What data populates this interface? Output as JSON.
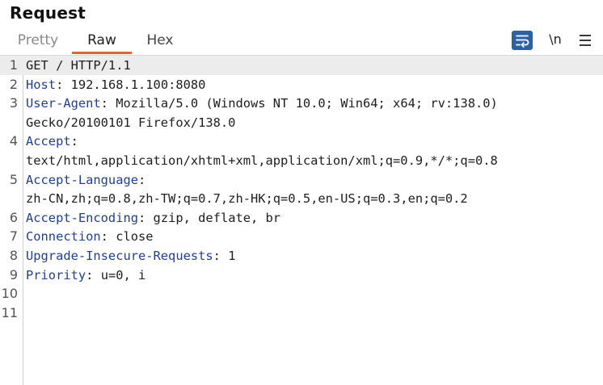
{
  "panel": {
    "title": "Request"
  },
  "tabs": [
    {
      "label": "Pretty",
      "active": false
    },
    {
      "label": "Raw",
      "active": true
    },
    {
      "label": "Hex",
      "active": false
    }
  ],
  "toolbar": {
    "wrap_icon": "wrap-lines-icon",
    "newline_label": "\\n",
    "menu_icon": "hamburger-menu-icon"
  },
  "colors": {
    "accent_tab": "#e8642e",
    "header_name": "#1f3f9f",
    "wrap_button": "#2a62a8"
  },
  "lines": [
    {
      "num": "1",
      "rows": [
        {
          "plain": "GET / HTTP/1.1"
        }
      ]
    },
    {
      "num": "2",
      "rows": [
        {
          "name": "Host",
          "value": " 192.168.1.100:8080"
        }
      ]
    },
    {
      "num": "3",
      "rows": [
        {
          "name": "User-Agent",
          "value": " Mozilla/5.0 (Windows NT 10.0; Win64; x64; rv:138.0)"
        },
        {
          "plain": "Gecko/20100101 Firefox/138.0"
        }
      ]
    },
    {
      "num": "4",
      "rows": [
        {
          "name": "Accept",
          "value": ""
        },
        {
          "plain": "text/html,application/xhtml+xml,application/xml;q=0.9,*/*;q=0.8"
        }
      ]
    },
    {
      "num": "5",
      "rows": [
        {
          "name": "Accept-Language",
          "value": ""
        },
        {
          "plain": "zh-CN,zh;q=0.8,zh-TW;q=0.7,zh-HK;q=0.5,en-US;q=0.3,en;q=0.2"
        }
      ]
    },
    {
      "num": "6",
      "rows": [
        {
          "name": "Accept-Encoding",
          "value": " gzip, deflate, br"
        }
      ]
    },
    {
      "num": "7",
      "rows": [
        {
          "name": "Connection",
          "value": " close"
        }
      ]
    },
    {
      "num": "8",
      "rows": [
        {
          "name": "Upgrade-Insecure-Requests",
          "value": " 1"
        }
      ]
    },
    {
      "num": "9",
      "rows": [
        {
          "name": "Priority",
          "value": " u=0, i"
        }
      ]
    },
    {
      "num": "10",
      "rows": [
        {
          "plain": ""
        }
      ]
    },
    {
      "num": "11",
      "rows": [
        {
          "plain": ""
        }
      ]
    }
  ]
}
